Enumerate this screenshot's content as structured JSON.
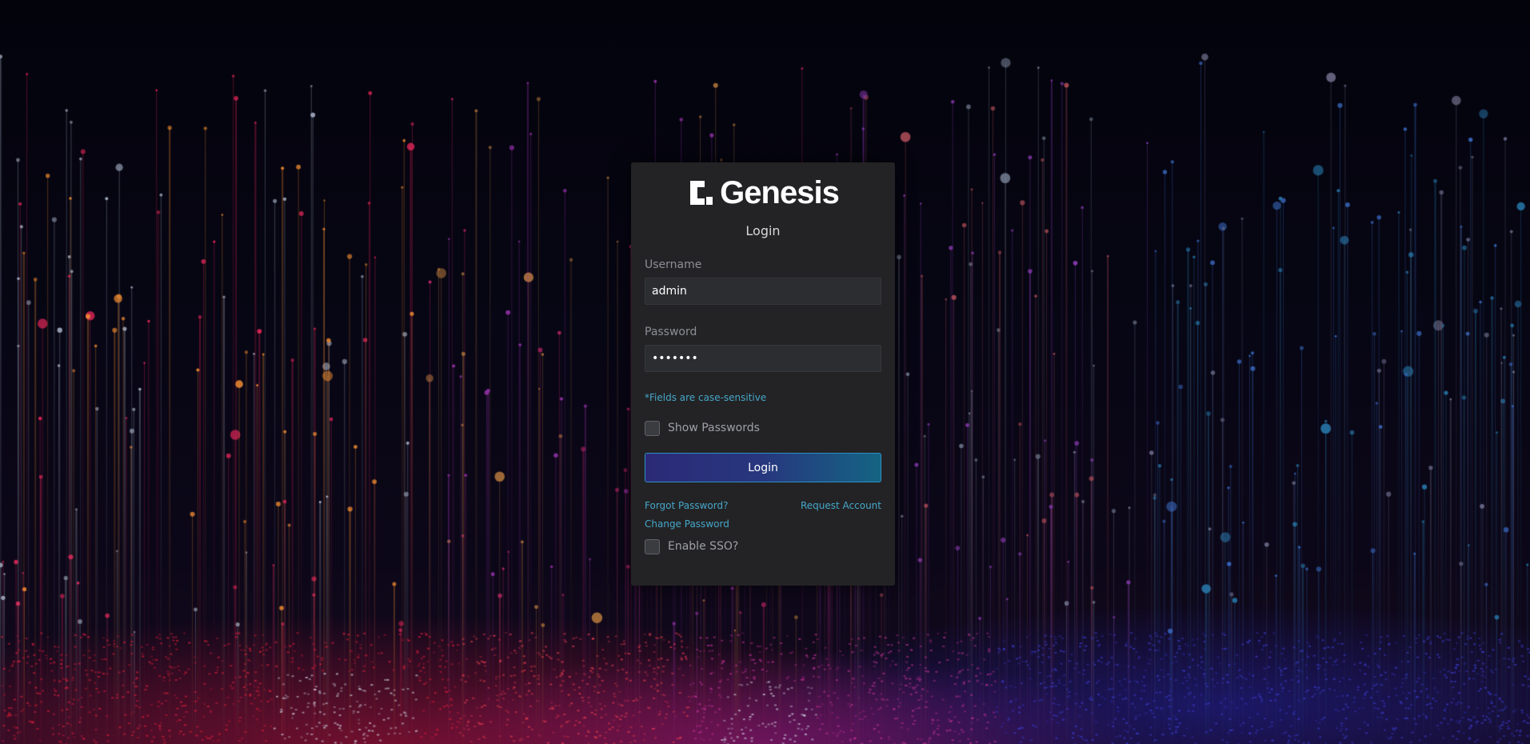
{
  "brand": {
    "name": "Genesis",
    "logo_icon": "genesis-logo-mark-icon",
    "accent_color": "#45a6c8"
  },
  "login_form": {
    "title": "Login",
    "username": {
      "label": "Username",
      "value": "admin"
    },
    "password": {
      "label": "Password",
      "value": "1234567"
    },
    "note": "*Fields are case-sensitive",
    "show_passwords": {
      "label": "Show Passwords",
      "checked": false
    },
    "submit_label": "Login",
    "forgot_password": "Forgot Password?",
    "request_account": "Request Account",
    "change_password": "Change Password",
    "enable_sso": {
      "label": "Enable SSO?",
      "checked": false
    }
  }
}
